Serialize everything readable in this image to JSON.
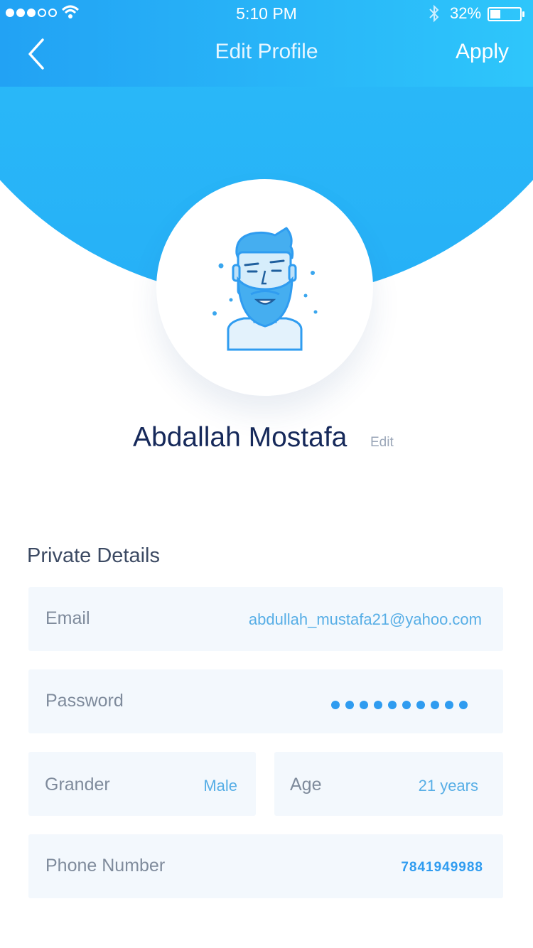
{
  "status_bar": {
    "time": "5:10 PM",
    "battery_percent": "32%",
    "battery_level": 0.32,
    "signal_bars_filled": 3,
    "signal_bars_total": 5,
    "icons": [
      "wifi-icon",
      "bluetooth-icon",
      "battery-icon"
    ]
  },
  "nav": {
    "title": "Edit Profile",
    "apply_label": "Apply",
    "back_icon": "chevron-left-icon"
  },
  "profile": {
    "name": "Abdallah Mostafa",
    "edit_label": "Edit",
    "avatar_icon": "bearded-man-avatar-icon"
  },
  "private_details": {
    "title": "Private Details",
    "email": {
      "label": "Email",
      "value": "abdullah_mustafa21@yahoo.com"
    },
    "password": {
      "label": "Password",
      "masked_length": 10
    },
    "gender": {
      "label": "Grander",
      "value": "Male"
    },
    "age": {
      "label": "Age",
      "value": "21 years"
    },
    "phone": {
      "label": "Phone Number",
      "value": "7841949988"
    }
  },
  "colors": {
    "header_gradient_start": "#22a2f4",
    "header_gradient_end": "#2ec6fb",
    "name_text": "#16295a",
    "value_text": "#57aee6",
    "field_bg": "#f3f8fd"
  }
}
